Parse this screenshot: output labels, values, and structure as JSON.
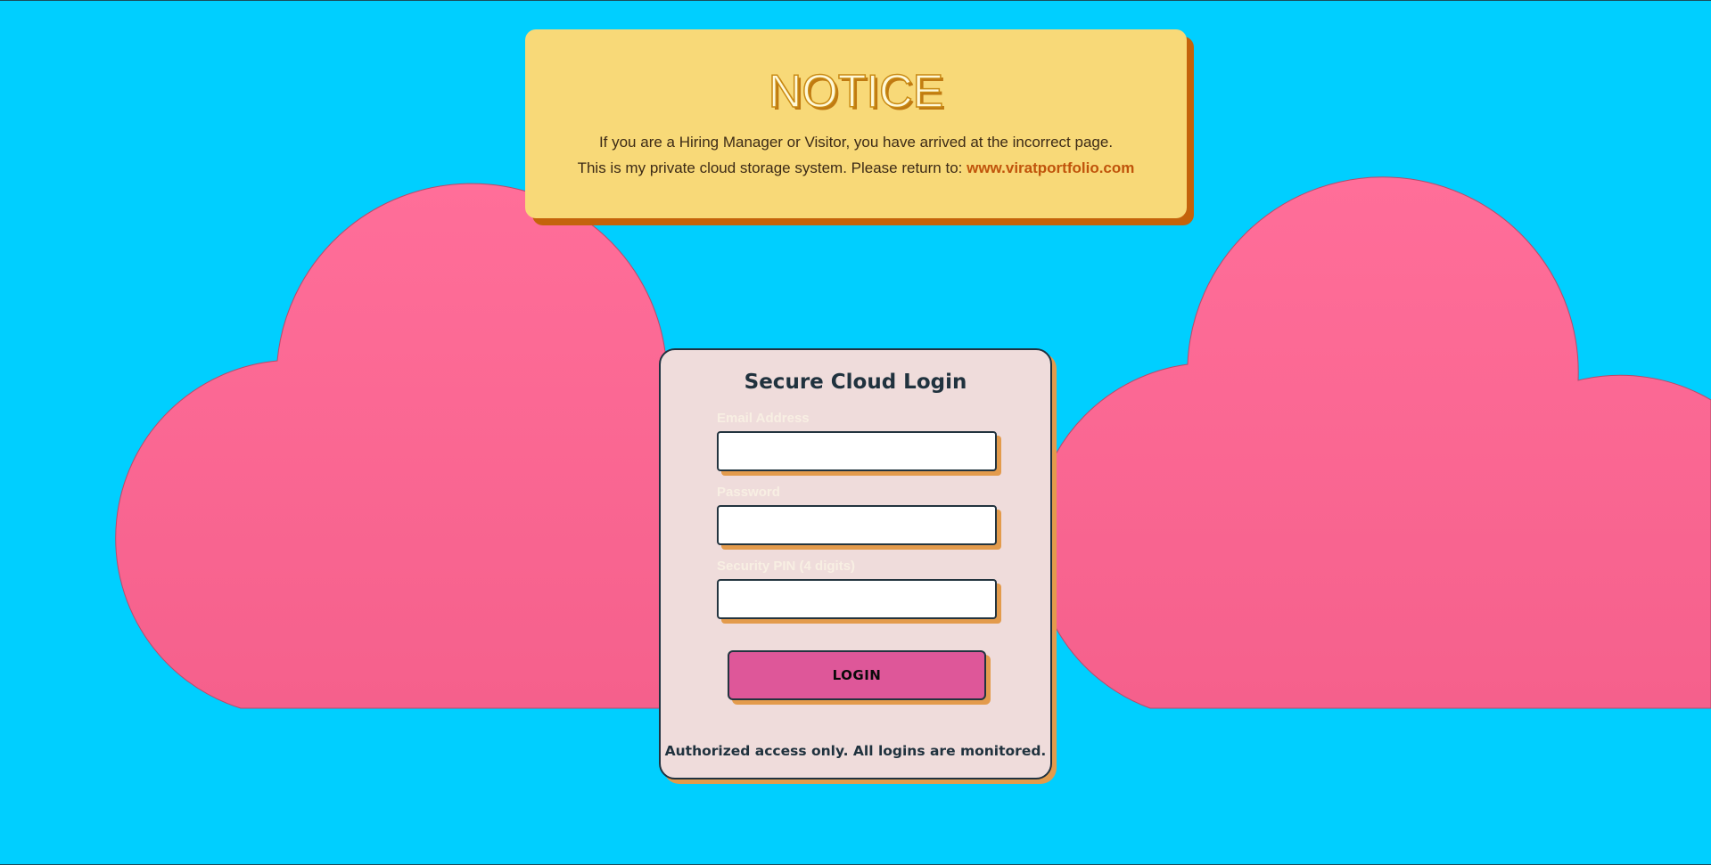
{
  "notice": {
    "title": "NOTICE",
    "line1": "If you are a Hiring Manager or Visitor, you have arrived at the incorrect page.",
    "line2_prefix": "This is my private cloud storage system. Please return to: ",
    "link_text": "www.viratportfolio.com"
  },
  "login": {
    "title": "Secure Cloud Login",
    "email_label": "Email Address",
    "email_value": "",
    "password_label": "Password",
    "password_value": "",
    "pin_label": "Security PIN (4 digits)",
    "pin_value": "",
    "button_label": "LOGIN",
    "footer": "Authorized access only. All logins are monitored."
  },
  "colors": {
    "background": "#00cfff",
    "cloud": "#fb6c97",
    "notice_bg": "#f8d978",
    "notice_shadow": "#c4630b",
    "card_bg": "#efdcdb",
    "accent_shadow": "#e39b4c",
    "button": "#de5799",
    "link": "#c0540b"
  }
}
